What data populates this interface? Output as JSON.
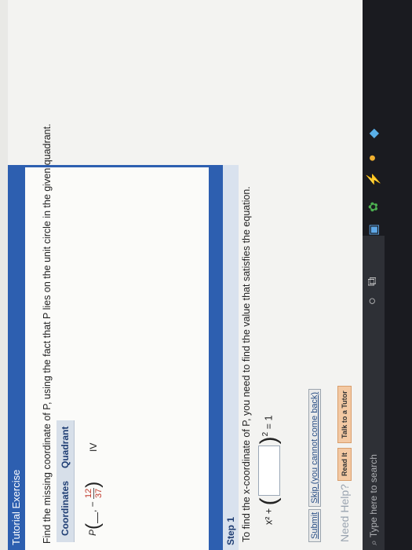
{
  "tutorial": {
    "header": "Tutorial Exercise",
    "question": "Find the missing coordinate of P, using the fact that P lies on the unit circle in the given quadrant."
  },
  "table": {
    "headers": [
      "Coordinates",
      "Quadrant"
    ],
    "point_label": "P",
    "fraction_numerator": "12",
    "fraction_denominator": "37",
    "quadrant": "IV"
  },
  "step": {
    "title": "Step 1",
    "text": "To find the x-coordinate of P, you need to find the value that satisfies the equation.",
    "equation_left": "x² +",
    "exponent": "2",
    "equation_right": "= 1"
  },
  "buttons": {
    "submit": "Submit",
    "skip": "Skip (you cannot come back)"
  },
  "help": {
    "need_help": "Need Help?",
    "read_it": "Read It",
    "talk_to_tutor": "Talk to a Tutor"
  },
  "taskbar": {
    "search_placeholder": "Type here to search"
  }
}
